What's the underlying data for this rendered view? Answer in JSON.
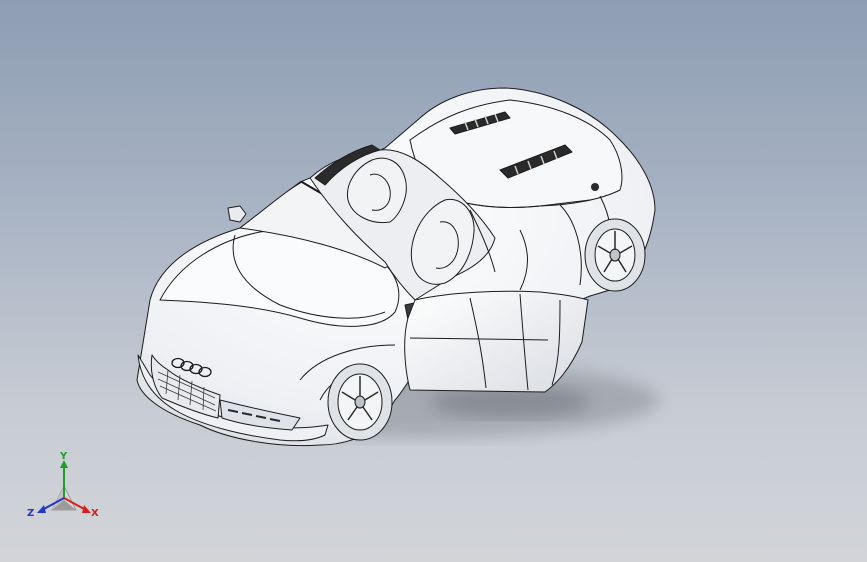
{
  "viewport": {
    "background_top": "#8e9db3",
    "background_bottom": "#d2d4d8"
  },
  "model": {
    "body_color": "#f4f4f8",
    "edge_color": "#1c1c1c",
    "shadow_color": "#7d828a",
    "logo_icon": "four-rings-logo"
  },
  "triad": {
    "x_label": "X",
    "y_label": "Y",
    "z_label": "Z",
    "x_color": "#d62020",
    "y_color": "#1e9e2a",
    "z_color": "#2436c9"
  }
}
